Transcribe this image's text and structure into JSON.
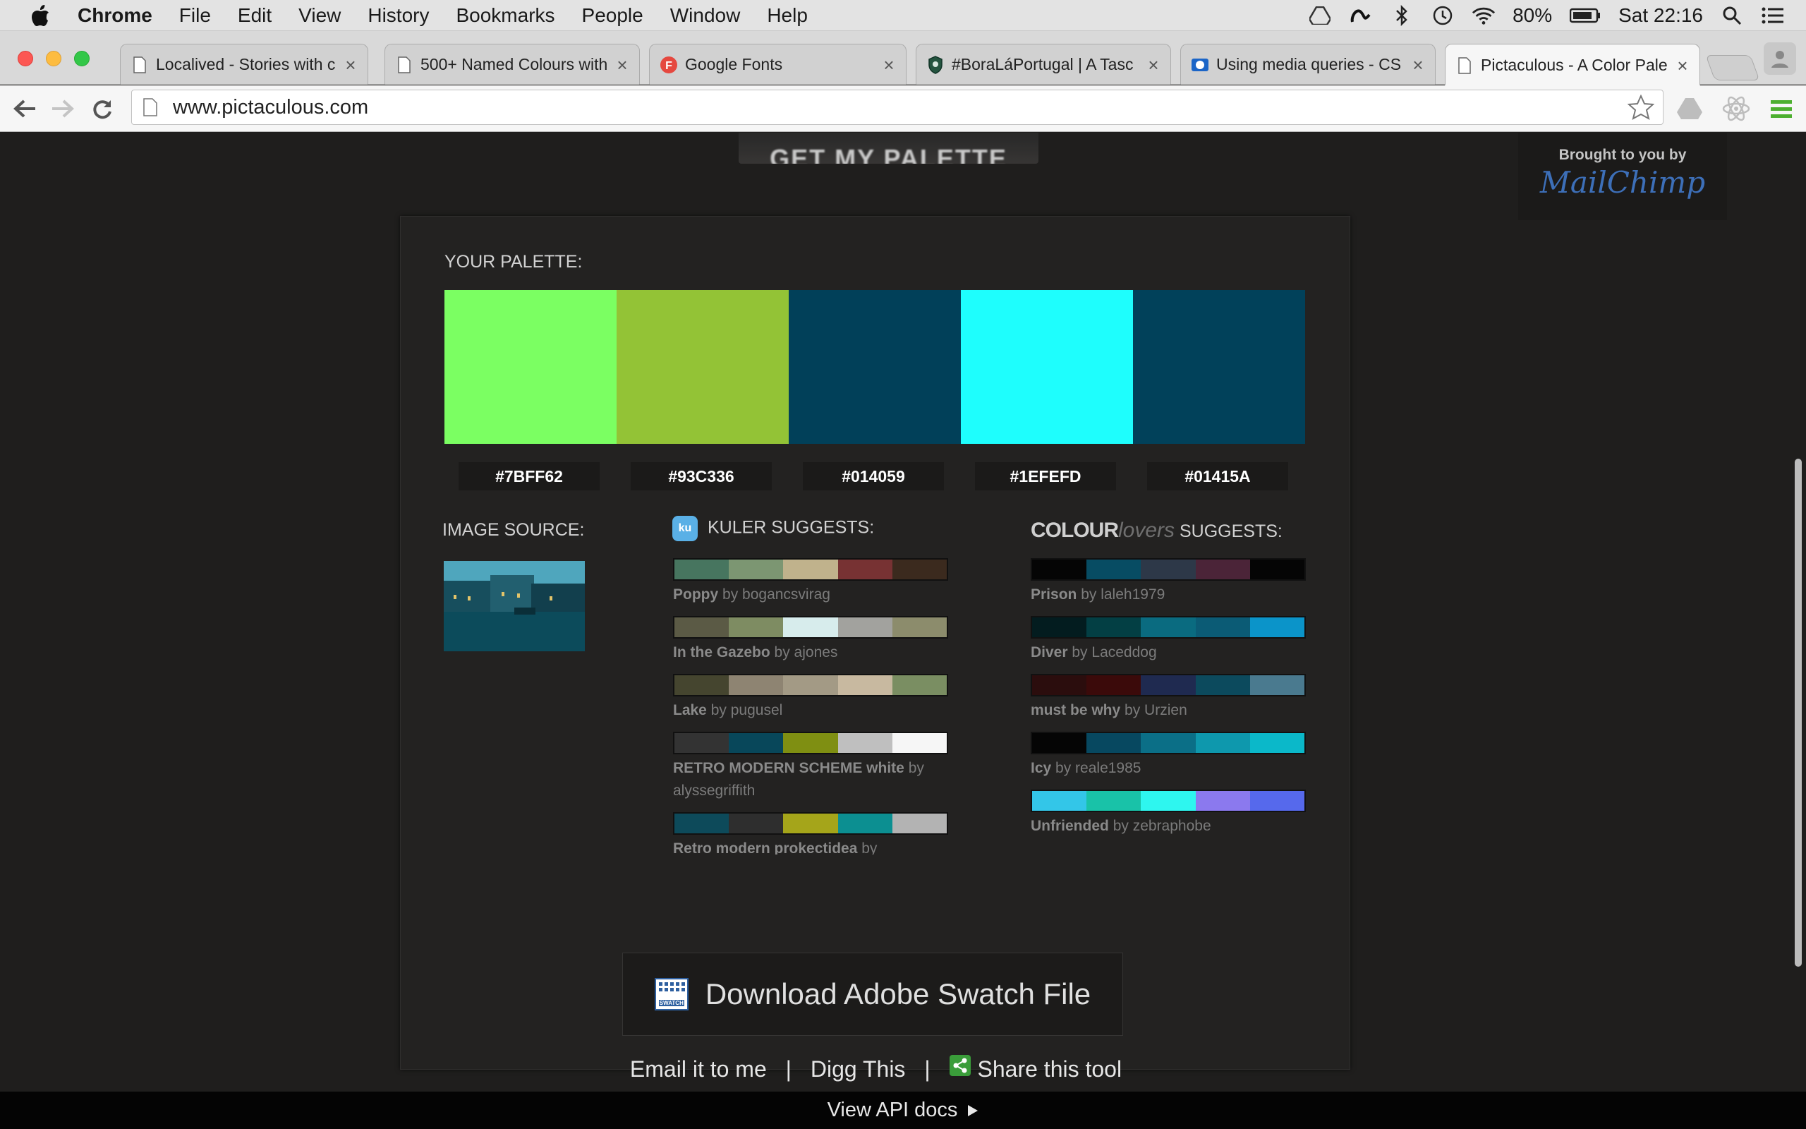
{
  "menubar": {
    "app": "Chrome",
    "menus": [
      "File",
      "Edit",
      "View",
      "History",
      "Bookmarks",
      "People",
      "Window",
      "Help"
    ],
    "battery": "80%",
    "clock": "Sat 22:16"
  },
  "tabs": [
    {
      "title": "Localived - Stories with c",
      "icon": "page-icon"
    },
    {
      "title": "500+ Named Colours with",
      "icon": "page-icon"
    },
    {
      "title": "Google Fonts",
      "icon": "google-fonts-icon"
    },
    {
      "title": "#BoraLáPortugal | A Tasc",
      "icon": "shield-icon"
    },
    {
      "title": "Using media queries - CS",
      "icon": "mdn-icon"
    },
    {
      "title": "Pictaculous - A Color Pale",
      "icon": "page-icon",
      "active": true
    }
  ],
  "omnibox": {
    "url": "www.pictaculous.com"
  },
  "page": {
    "get_palette": "GET MY PALETTE",
    "mailchimp": {
      "brought_by": "Brought to you by",
      "brand": "MailChimp"
    },
    "palette_label": "YOUR PALETTE:",
    "palette": [
      "#7BFF62",
      "#93C336",
      "#014059",
      "#1EFEFD",
      "#01415A"
    ],
    "image_source_label": "IMAGE SOURCE:",
    "kuler": {
      "icon_text": "ku",
      "label": "KULER SUGGESTS:",
      "items": [
        {
          "name": "Poppy",
          "by": "by bogancsvirag",
          "colors": [
            "#47755f",
            "#7c9672",
            "#c0b28c",
            "#773233",
            "#3b2a1e"
          ]
        },
        {
          "name": "In the Gazebo",
          "by": "by ajones",
          "colors": [
            "#5b5a45",
            "#7e8c62",
            "#d7ecec",
            "#a2a29e",
            "#8c8c6c"
          ]
        },
        {
          "name": "Lake",
          "by": "by pugusel",
          "colors": [
            "#45452f",
            "#8e8472",
            "#a39a85",
            "#c8b9a0",
            "#7a8e62"
          ]
        },
        {
          "name": "RETRO MODERN SCHEME white",
          "by": "by alyssegriffith",
          "colors": [
            "#333333",
            "#08475a",
            "#7f8f12",
            "#bfbfbf",
            "#f6f6f6"
          ]
        },
        {
          "name": "Retro modern prokectidea",
          "by": "by",
          "colors": [
            "#0d4a5a",
            "#2e2e2e",
            "#a5a51a",
            "#0c8f91",
            "#b3b3b3"
          ]
        }
      ]
    },
    "colourlovers": {
      "brand_bold": "COLOUR",
      "brand_light": "lovers",
      "label": "SUGGESTS:",
      "items": [
        {
          "name": "Prison",
          "by": "by laleh1979",
          "colors": [
            "#050505",
            "#074c63",
            "#2d3848",
            "#4b2438",
            "#050505"
          ]
        },
        {
          "name": "Diver",
          "by": "by Laceddog",
          "colors": [
            "#031c1f",
            "#033f44",
            "#0a6b80",
            "#0b5b75",
            "#0b94c9"
          ]
        },
        {
          "name": "must be why",
          "by": "by Urzien",
          "colors": [
            "#2b0d0d",
            "#3b0a0a",
            "#1f2a50",
            "#0c4a5d",
            "#4a7a8f"
          ]
        },
        {
          "name": "Icy",
          "by": "by reale1985",
          "colors": [
            "#050505",
            "#074860",
            "#0b6f87",
            "#0e98ad",
            "#0bb8c9"
          ]
        },
        {
          "name": "Unfriended",
          "by": "by zebraphobe",
          "colors": [
            "#33c6e8",
            "#19c2a8",
            "#2ef6ef",
            "#8b79ee",
            "#5669ec"
          ]
        }
      ]
    },
    "download_label": "Download Adobe Swatch File",
    "download_icon_text": "SWATCH",
    "links": {
      "email": "Email it to me",
      "sep": "|",
      "digg": "Digg This",
      "share": "Share this tool"
    },
    "api": "View API docs"
  }
}
